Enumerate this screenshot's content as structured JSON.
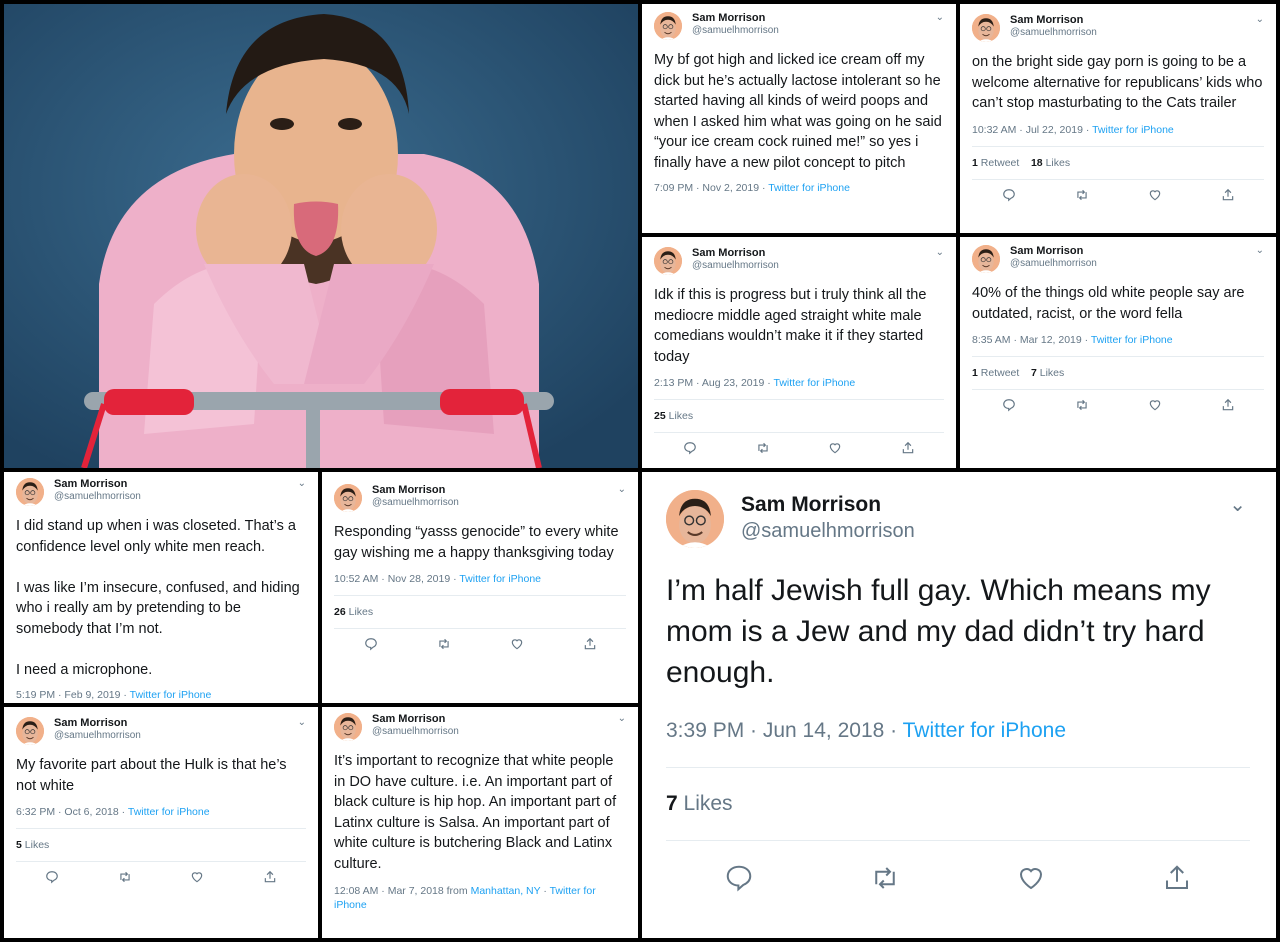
{
  "user": {
    "name": "Sam Morrison",
    "handle": "@samuelhmorrison"
  },
  "colors": {
    "link": "#1da1f2",
    "secondary": "#657786",
    "text": "#14171a",
    "hoodie": "#eeaec8",
    "background": "#2f5a78"
  },
  "photo": {
    "description_icon": "portrait-photo"
  },
  "tweets": {
    "t1": {
      "text": "My bf got high and licked ice cream off my dick but he’s actually lactose intolerant so he started having all kinds of weird poops and when I asked him what was going on he said “your ice cream cock ruined me!” so yes i finally have a new pilot concept to pitch",
      "time": "7:09 PM · Nov 2, 2019",
      "source": "Twitter for iPhone"
    },
    "t2": {
      "text": "on the bright side gay porn is going to be a welcome alternative for republicans’ kids who can’t stop masturbating to the Cats trailer",
      "time": "10:32 AM · Jul 22, 2019",
      "source": "Twitter for iPhone",
      "retweets": "1",
      "retweets_label": "Retweet",
      "likes": "18",
      "likes_label": "Likes"
    },
    "t3": {
      "text": "Idk if this is progress but i truly think all the mediocre middle aged straight white male comedians wouldn’t make it if they started today",
      "time": "2:13 PM · Aug 23, 2019",
      "source": "Twitter for iPhone",
      "likes": "25",
      "likes_label": "Likes"
    },
    "t4": {
      "text": "40% of the things old white people say are outdated, racist, or the word fella",
      "time": "8:35 AM · Mar 12, 2019",
      "source": "Twitter for iPhone",
      "retweets": "1",
      "retweets_label": "Retweet",
      "likes": "7",
      "likes_label": "Likes"
    },
    "t5": {
      "text": "I did stand up when i was closeted. That’s a confidence level only white men reach.\n\nI was like I’m insecure, confused, and hiding who i really am by pretending to be somebody that I’m not.\n\nI need a microphone.",
      "time": "5:19 PM · Feb 9, 2019",
      "source": "Twitter for iPhone"
    },
    "t6": {
      "text": "Responding “yasss genocide” to every white gay wishing me a happy thanksgiving today",
      "time": "10:52 AM · Nov 28, 2019",
      "source": "Twitter for iPhone",
      "likes": "26",
      "likes_label": "Likes"
    },
    "t7": {
      "text": "My favorite part about the Hulk is that he’s not white",
      "time": "6:32 PM · Oct 6, 2018",
      "source": "Twitter for iPhone",
      "likes": "5",
      "likes_label": "Likes"
    },
    "t8": {
      "text": "It’s important to recognize that white people in DO have culture. i.e. An important part of black culture is hip hop. An important part of Latinx culture is Salsa. An important part of white culture is butchering Black and Latinx culture.",
      "time": "12:08 AM · Mar 7, 2018 from",
      "location": "Manhattan, NY",
      "source": "Twitter for iPhone"
    },
    "t9": {
      "text": "I’m half Jewish full gay. Which means my mom is a Jew and my dad didn’t try hard enough.",
      "time": "3:39 PM · Jun 14, 2018",
      "source": "Twitter for iPhone",
      "likes": "7",
      "likes_label": "Likes"
    }
  },
  "separator": " · "
}
